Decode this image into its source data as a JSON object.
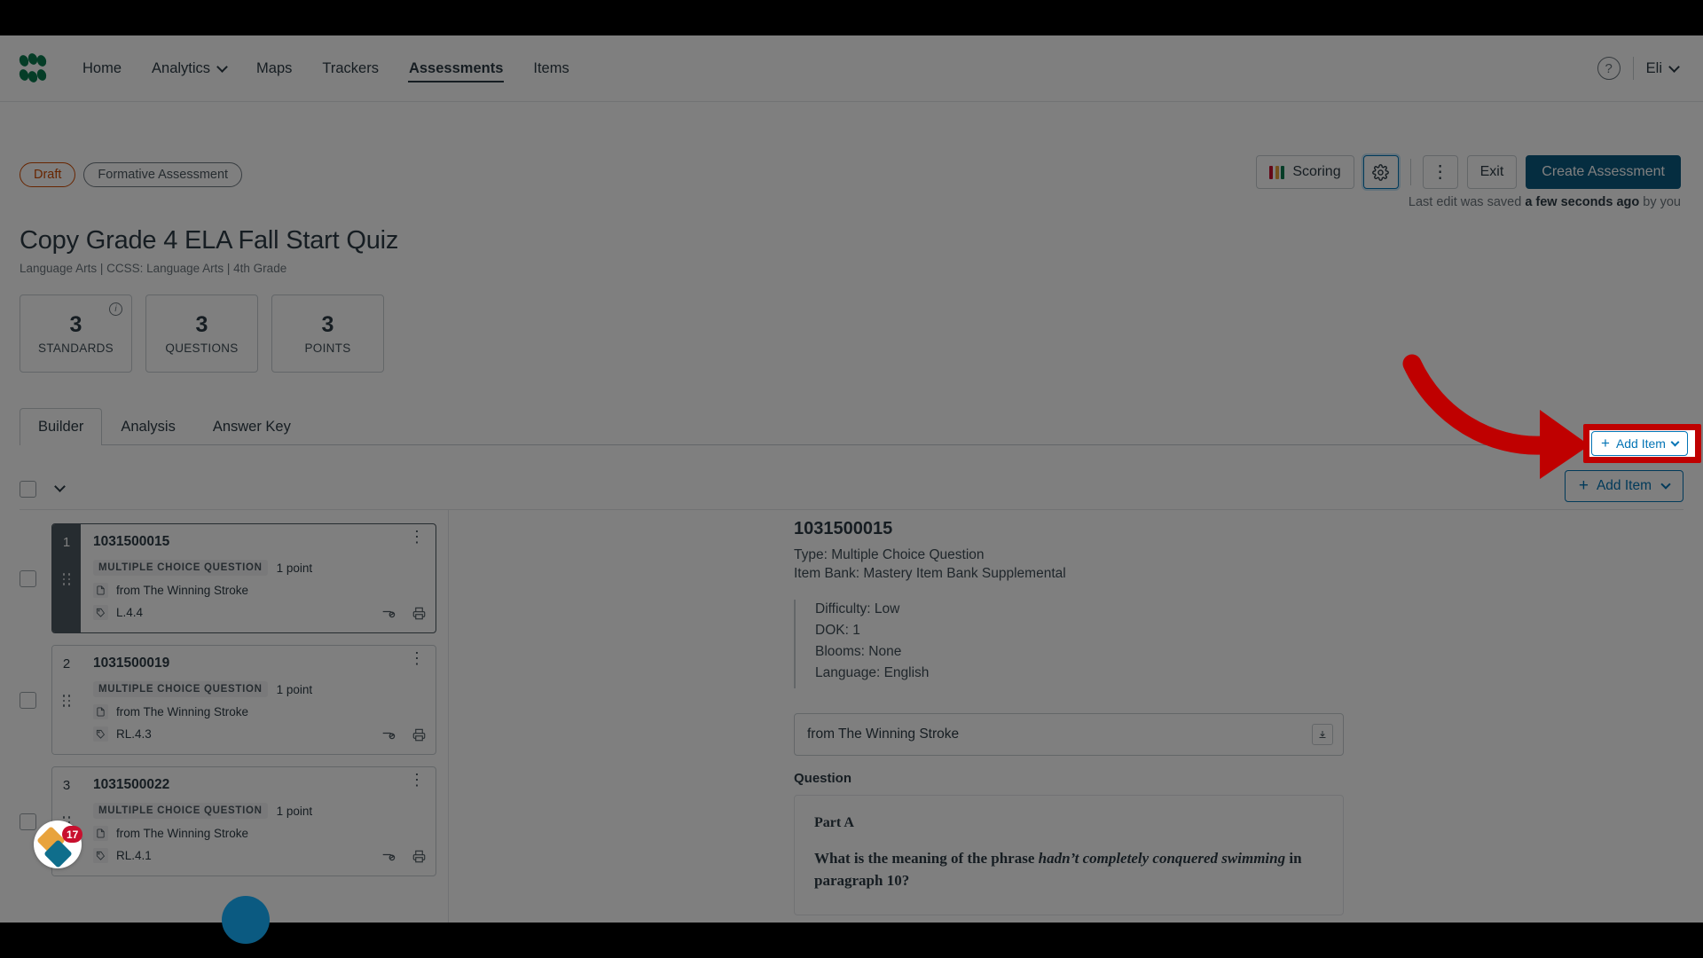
{
  "nav": {
    "logo_name": "mastery-connect-logo",
    "items": [
      {
        "label": "Home",
        "active": false,
        "dropdown": false
      },
      {
        "label": "Analytics",
        "active": false,
        "dropdown": true
      },
      {
        "label": "Maps",
        "active": false,
        "dropdown": false
      },
      {
        "label": "Trackers",
        "active": false,
        "dropdown": false
      },
      {
        "label": "Assessments",
        "active": true,
        "dropdown": false
      },
      {
        "label": "Items",
        "active": false,
        "dropdown": false
      }
    ],
    "help_glyph": "?",
    "user_label": "Eli"
  },
  "header": {
    "status_badge": "Draft",
    "type_badge": "Formative Assessment",
    "title": "Copy Grade 4 ELA Fall Start Quiz",
    "subtitle": "Language Arts  |  CCSS: Language Arts  |  4th Grade",
    "saved_prefix": "Last edit was saved ",
    "saved_strong": "a few seconds ago",
    "saved_suffix": " by you"
  },
  "toolbar": {
    "scoring_label": "Scoring",
    "scoring_bar_colors": [
      "#c8102e",
      "#e8a33d",
      "#0a7a4f"
    ],
    "settings_label": "gear",
    "kebab_label": "⋮",
    "exit_label": "Exit",
    "create_label": "Create Assessment",
    "primary_color": "#0b5a81"
  },
  "stats": [
    {
      "number": "3",
      "label": "STANDARDS",
      "has_info": true
    },
    {
      "number": "3",
      "label": "QUESTIONS",
      "has_info": false
    },
    {
      "number": "3",
      "label": "POINTS",
      "has_info": false
    }
  ],
  "tabs": [
    {
      "label": "Builder",
      "active": true
    },
    {
      "label": "Analysis",
      "active": false
    },
    {
      "label": "Answer Key",
      "active": false
    }
  ],
  "list_toolbar": {
    "add_item_label": "Add Item",
    "add_item_plus": "+",
    "accent_color": "#0374b5"
  },
  "items": [
    {
      "index": "1",
      "id": "1031500015",
      "type_pill": "MULTIPLE CHOICE QUESTION",
      "points": "1 point",
      "passage": "from The Winning Stroke",
      "standard": "L.4.4",
      "selected": true
    },
    {
      "index": "2",
      "id": "1031500019",
      "type_pill": "MULTIPLE CHOICE QUESTION",
      "points": "1 point",
      "passage": "from The Winning Stroke",
      "standard": "RL.4.3",
      "selected": false
    },
    {
      "index": "3",
      "id": "1031500022",
      "type_pill": "MULTIPLE CHOICE QUESTION",
      "points": "1 point",
      "passage": "from The Winning Stroke",
      "standard": "RL.4.1",
      "selected": false
    }
  ],
  "detail": {
    "id": "1031500015",
    "type_line": "Type: Multiple Choice Question",
    "bank_line": "Item Bank: Mastery Item Bank Supplemental",
    "attributes": [
      "Difficulty: Low",
      "DOK: 1",
      "Blooms: None",
      "Language: English"
    ],
    "passage_title": "from The Winning Stroke",
    "question_label": "Question",
    "part_label": "Part A",
    "question_text_pre": "What is the meaning of the phrase ",
    "question_text_italic": "hadn’t completely conquered swimming",
    "question_text_post": " in paragraph 10?"
  },
  "floating": {
    "pendo_count": "17"
  },
  "annotation": {
    "arrow_color": "#bf0000",
    "highlight_target": "Add Item"
  }
}
